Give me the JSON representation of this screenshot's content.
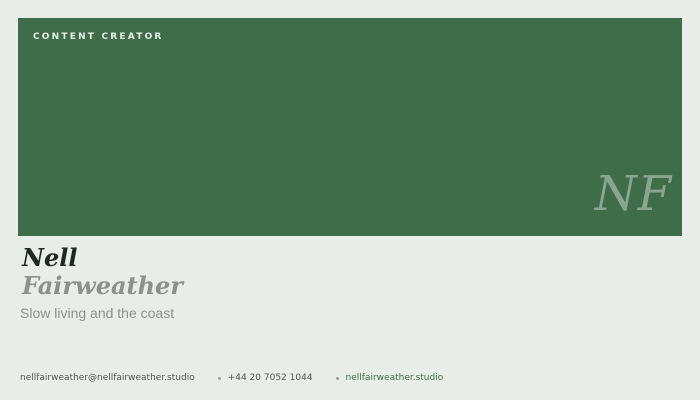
{
  "banner": {
    "role": "CONTENT CREATOR",
    "monogram": "NF"
  },
  "profile": {
    "first_name": "Nell",
    "last_name": "Fairweather",
    "tagline": "Slow living and the coast"
  },
  "contact": {
    "email": "nellfairweather@nellfairweather.studio",
    "phone": "+44 20 7052 1044",
    "website": "nellfairweather.studio"
  },
  "colors": {
    "background": "#e8ede8",
    "banner": "#3f6d4a",
    "accent": "#3f6d4a",
    "muted_text": "#8b9289"
  }
}
